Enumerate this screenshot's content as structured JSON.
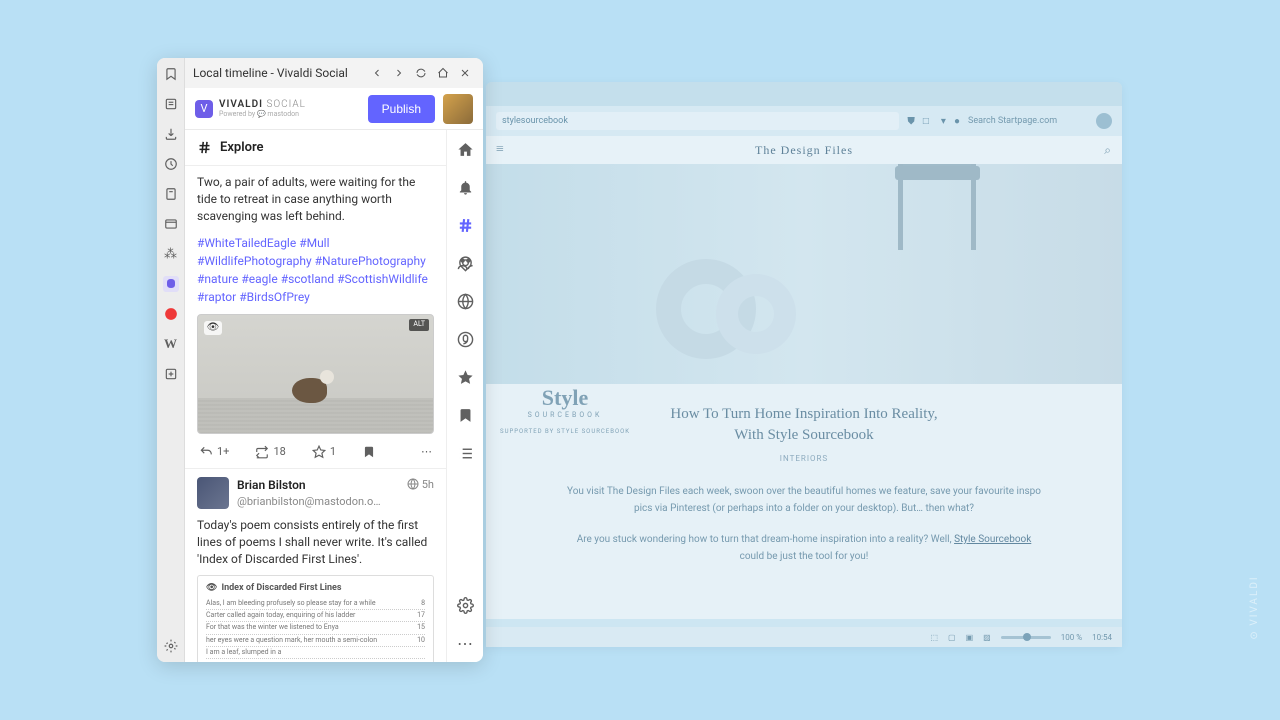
{
  "bg_window": {
    "address": "stylesourcebook",
    "search_placeholder": "Search Startpage.com",
    "header_title": "The Design Files",
    "logo_main": "Style",
    "logo_sub": "SOURCEBOOK",
    "logo_supported": "SUPPORTED BY STYLE SOURCEBOOK",
    "article_title_1": "How To Turn Home Inspiration Into Reality,",
    "article_title_2": "With Style Sourcebook",
    "article_category": "INTERIORS",
    "article_p1": "You visit The Design Files each week, swoon over the beautiful homes we feature, save your favourite inspo pics via Pinterest (or perhaps into a folder on your desktop). But… then what?",
    "article_p2a": "Are you stuck wondering how to turn that dream-home inspiration into a reality? Well, ",
    "article_p2_link": "Style Sourcebook",
    "article_p2b": " could be just the tool for you!",
    "zoom_pct": "100 %",
    "time": "10:54"
  },
  "panel": {
    "title": "Local timeline - Vivaldi Social",
    "brand": "VIVALDI",
    "brand_sub": "SOCIAL",
    "powered": "Powered by 💬 mastodon",
    "publish": "Publish",
    "explore": "Explore"
  },
  "post1": {
    "text": "Two, a pair of adults, were waiting for the tide to retreat in case anything worth scavenging was left behind.",
    "tags": [
      "#WhiteTailedEagle",
      "#Mull",
      "#WildlifePhotography",
      "#NaturePhotography",
      "#nature",
      "#eagle",
      "#scotland",
      "#ScottishWildlife",
      "#raptor",
      "#BirdsOfPrey"
    ],
    "replies": "1+",
    "boosts": "18",
    "favs": "1"
  },
  "post2": {
    "name": "Brian Bilston",
    "handle": "@brianbilston@mastodon.o…",
    "time": "5h",
    "body": "Today's poem consists entirely of the first lines of poems I shall never write. It's called 'Index of Discarded First Lines'.",
    "doc_title": "Index of Discarded First Lines",
    "lines": [
      {
        "t": "Alas, I am bleeding profusely so please stay for a while",
        "n": "8"
      },
      {
        "t": "Carter called again today, enquiring of his ladder",
        "n": "17"
      },
      {
        "t": "For that was the winter we listened to Enya",
        "n": "15"
      },
      {
        "t": "her eyes were a question mark, her mouth a semi-colon",
        "n": "10"
      },
      {
        "t": "I am a leaf, slumped in a",
        "n": ""
      }
    ]
  },
  "watermark": "VIVALDI"
}
